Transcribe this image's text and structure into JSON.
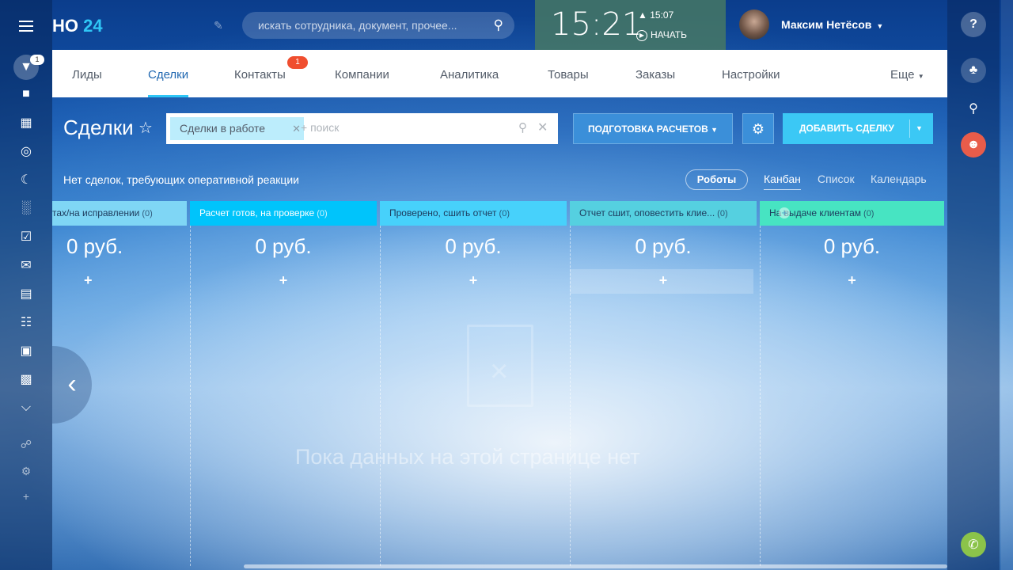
{
  "app": {
    "logo_text": "НО",
    "logo_number": "24"
  },
  "header": {
    "search_placeholder": "искать сотрудника, документ, прочее...",
    "clock_time": "15:21",
    "clock_alarm": "15:07",
    "clock_start": "НАЧАТЬ",
    "user_name": "Максим Нетёсов"
  },
  "left_sidebar": {
    "active_badge": "1"
  },
  "tabs": [
    {
      "label": "Лиды"
    },
    {
      "label": "Сделки"
    },
    {
      "label": "Контакты",
      "badge": "1"
    },
    {
      "label": "Компании"
    },
    {
      "label": "Аналитика"
    },
    {
      "label": "Товары"
    },
    {
      "label": "Заказы"
    },
    {
      "label": "Настройки"
    },
    {
      "label": "Еще"
    }
  ],
  "page": {
    "title": "Сделки",
    "filter_tag": "Сделки в работе",
    "filter_search_placeholder": "+ поиск",
    "btn_prep": "ПОДГОТОВКА РАСЧЕТОВ",
    "btn_add": "ДОБАВИТЬ СДЕЛКУ"
  },
  "kanban": {
    "no_deals_text": "Нет сделок, требующих оперативной реакции",
    "robots_label": "Роботы",
    "views": [
      "Канбан",
      "Список",
      "Календарь"
    ],
    "columns": [
      {
        "title": "тах/на исправлении",
        "count": "(0)",
        "sum": "0 руб.",
        "color": "#7fd6f5"
      },
      {
        "title": "Расчет готов, на проверке",
        "count": "(0)",
        "sum": "0 руб.",
        "color": "#00c4fb"
      },
      {
        "title": "Проверено, сшить отчет",
        "count": "(0)",
        "sum": "0 руб.",
        "color": "#47d1fb"
      },
      {
        "title": "Отчет сшит, оповестить клие...",
        "count": "(0)",
        "sum": "0 руб.",
        "color": "#55d0e0"
      },
      {
        "title": "На выдаче клиентам",
        "count": "(0)",
        "sum": "0 руб.",
        "color": "#47e4c2"
      }
    ],
    "empty_text": "Пока данных на этой странице нет"
  }
}
